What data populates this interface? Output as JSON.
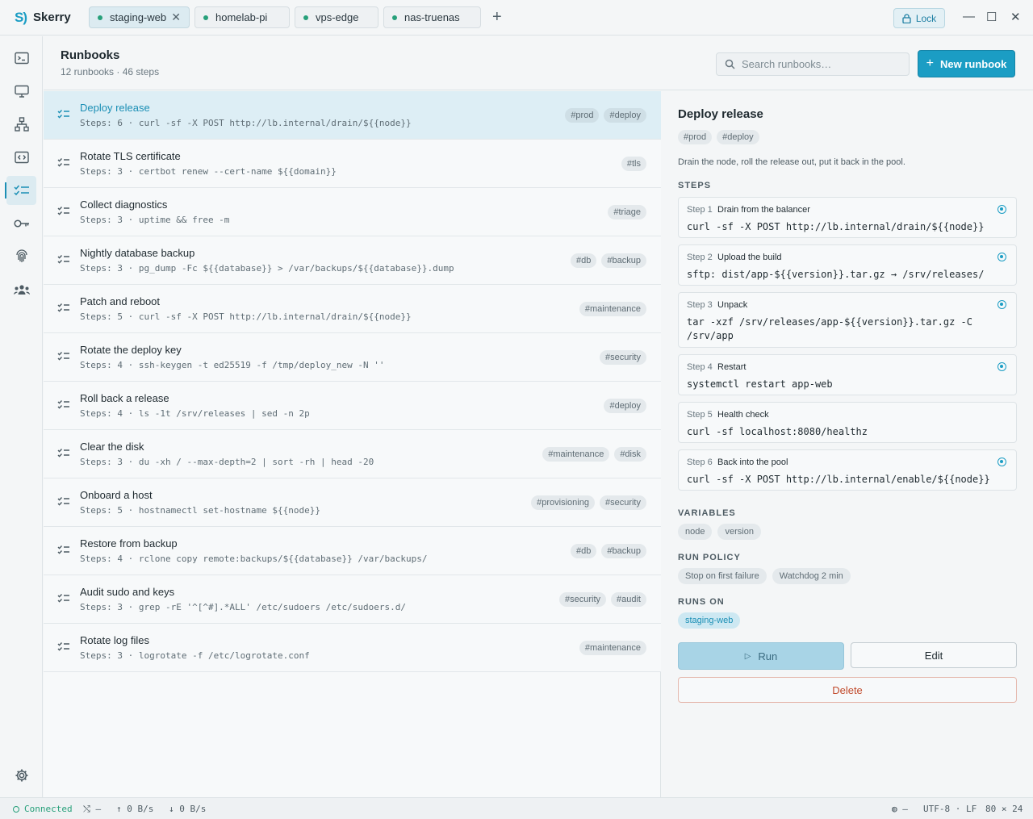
{
  "app": {
    "logo": "S)",
    "name": "Skerry"
  },
  "tabs": [
    {
      "label": "staging-web",
      "active": true,
      "closable": true
    },
    {
      "label": "homelab-pi",
      "active": false
    },
    {
      "label": "vps-edge",
      "active": false
    },
    {
      "label": "nas-truenas",
      "active": false
    }
  ],
  "tab_add": "+",
  "lock_label": "Lock",
  "window_controls": {
    "minimize": "—",
    "maximize": "☐",
    "close": "✕"
  },
  "sidebar": {
    "items": [
      {
        "name": "terminal-icon"
      },
      {
        "name": "monitor-icon"
      },
      {
        "name": "network-icon"
      },
      {
        "name": "code-icon"
      },
      {
        "name": "checklist-icon",
        "active": true
      },
      {
        "name": "key-icon"
      },
      {
        "name": "fingerprint-icon"
      },
      {
        "name": "team-icon"
      }
    ],
    "settings_icon": "gear-icon"
  },
  "header": {
    "title": "Runbooks",
    "subtitle": "12 runbooks · 46 steps",
    "search_placeholder": "Search runbooks…",
    "new_button": "New runbook"
  },
  "runbooks": [
    {
      "title": "Deploy release",
      "sub": "Steps: 6 · curl -sf -X POST http://lb.internal/drain/${{node}}",
      "tags": [
        "#prod",
        "#deploy"
      ],
      "selected": true
    },
    {
      "title": "Rotate TLS certificate",
      "sub": "Steps: 3 · certbot renew --cert-name ${{domain}}",
      "tags": [
        "#tls"
      ]
    },
    {
      "title": "Collect diagnostics",
      "sub": "Steps: 3 · uptime && free -m",
      "tags": [
        "#triage"
      ]
    },
    {
      "title": "Nightly database backup",
      "sub": "Steps: 3 · pg_dump -Fc ${{database}} > /var/backups/${{database}}.dump",
      "tags": [
        "#db",
        "#backup"
      ]
    },
    {
      "title": "Patch and reboot",
      "sub": "Steps: 5 · curl -sf -X POST http://lb.internal/drain/${{node}}",
      "tags": [
        "#maintenance"
      ]
    },
    {
      "title": "Rotate the deploy key",
      "sub": "Steps: 4 · ssh-keygen -t ed25519 -f /tmp/deploy_new -N ''",
      "tags": [
        "#security"
      ]
    },
    {
      "title": "Roll back a release",
      "sub": "Steps: 4 · ls -1t /srv/releases | sed -n 2p",
      "tags": [
        "#deploy"
      ]
    },
    {
      "title": "Clear the disk",
      "sub": "Steps: 3 · du -xh / --max-depth=2 | sort -rh | head -20",
      "tags": [
        "#maintenance",
        "#disk"
      ]
    },
    {
      "title": "Onboard a host",
      "sub": "Steps: 5 · hostnamectl set-hostname ${{node}}",
      "tags": [
        "#provisioning",
        "#security"
      ]
    },
    {
      "title": "Restore from backup",
      "sub": "Steps: 4 · rclone copy remote:backups/${{database}} /var/backups/",
      "tags": [
        "#db",
        "#backup"
      ]
    },
    {
      "title": "Audit sudo and keys",
      "sub": "Steps: 3 · grep -rE '^[^#].*ALL' /etc/sudoers /etc/sudoers.d/",
      "tags": [
        "#security",
        "#audit"
      ]
    },
    {
      "title": "Rotate log files",
      "sub": "Steps: 3 · logrotate -f /etc/logrotate.conf",
      "tags": [
        "#maintenance"
      ]
    }
  ],
  "detail": {
    "title": "Deploy release",
    "tags": [
      "#prod",
      "#deploy"
    ],
    "description": "Drain the node, roll the release out, put it back in the pool.",
    "steps_heading": "STEPS",
    "steps": [
      {
        "label": "Step 1",
        "name": "Drain from the balancer",
        "cmd": "curl -sf -X POST http://lb.internal/drain/${{node}}",
        "watch": true
      },
      {
        "label": "Step 2",
        "name": "Upload the build",
        "cmd": "sftp: dist/app-${{version}}.tar.gz → /srv/releases/",
        "watch": true
      },
      {
        "label": "Step 3",
        "name": "Unpack",
        "cmd": "tar -xzf /srv/releases/app-${{version}}.tar.gz -C /srv/app",
        "watch": true
      },
      {
        "label": "Step 4",
        "name": "Restart",
        "cmd": "systemctl restart app-web",
        "watch": true
      },
      {
        "label": "Step 5",
        "name": "Health check",
        "cmd": "curl -sf localhost:8080/healthz",
        "watch": false
      },
      {
        "label": "Step 6",
        "name": "Back into the pool",
        "cmd": "curl -sf -X POST http://lb.internal/enable/${{node}}",
        "watch": true
      }
    ],
    "variables_heading": "VARIABLES",
    "variables": [
      "node",
      "version"
    ],
    "policy_heading": "RUN POLICY",
    "policy": [
      "Stop on first failure",
      "Watchdog 2 min"
    ],
    "runs_on_heading": "RUNS ON",
    "runs_on": [
      "staging-web"
    ],
    "run_button": "Run",
    "edit_button": "Edit",
    "delete_button": "Delete"
  },
  "statusbar": {
    "connected": "Connected",
    "forward": "—",
    "up": "0 B/s",
    "down": "0 B/s",
    "globe": "—",
    "encoding": "UTF-8 · LF",
    "size": "80 × 24"
  },
  "colors": {
    "accent": "#1b9dc4",
    "connected": "#27a07a",
    "danger": "#c14a2b"
  }
}
